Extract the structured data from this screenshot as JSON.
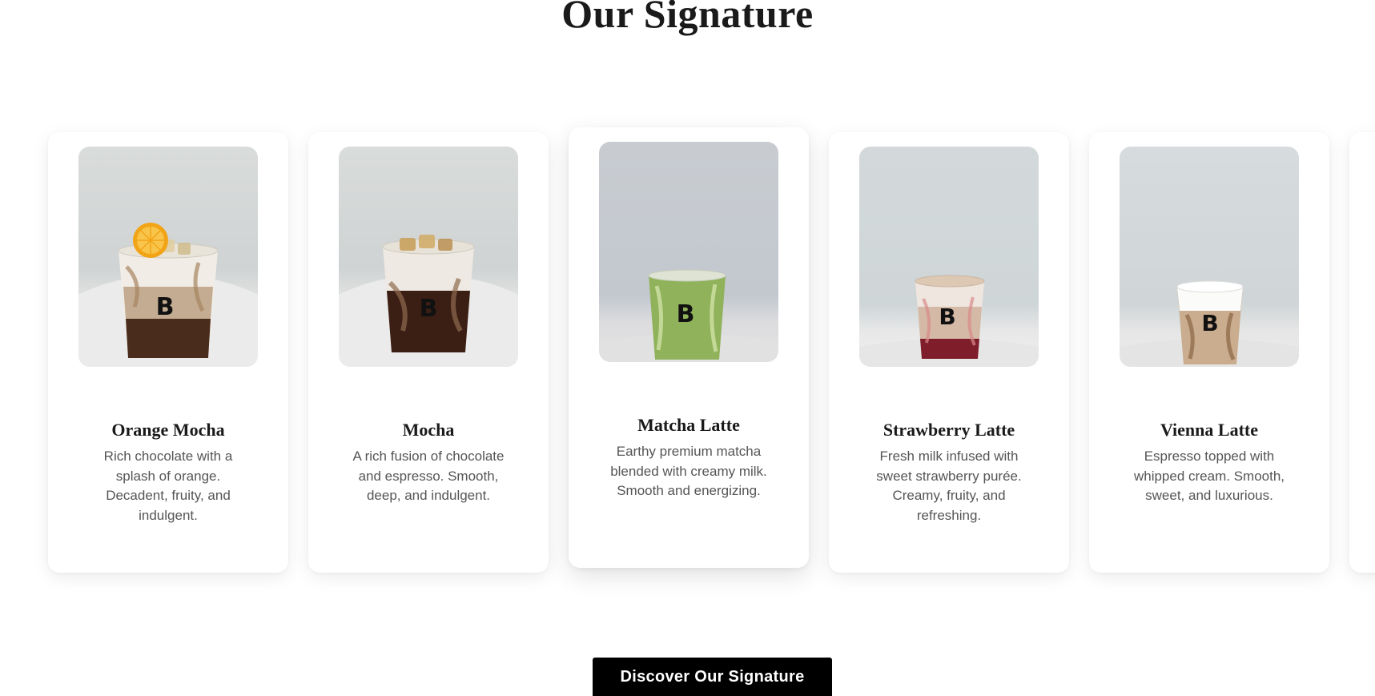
{
  "section": {
    "title": "Our Signature"
  },
  "cards": [
    {
      "name": "Orange Mocha",
      "description": "Rich chocolate with a splash of orange. Decadent, fruity, and indulgent."
    },
    {
      "name": "Mocha",
      "description": "A rich fusion of chocolate and espresso. Smooth, deep, and indulgent."
    },
    {
      "name": "Matcha Latte",
      "description": "Earthy premium matcha blended with creamy milk. Smooth and energizing."
    },
    {
      "name": "Strawberry Latte",
      "description": "Fresh milk infused with sweet strawberry purée. Creamy, fruity, and refreshing."
    },
    {
      "name": "Vienna Latte",
      "description": "Espresso topped with whipped cream. Smooth, sweet, and luxurious."
    }
  ],
  "cta": {
    "label": "Discover Our Signature"
  }
}
